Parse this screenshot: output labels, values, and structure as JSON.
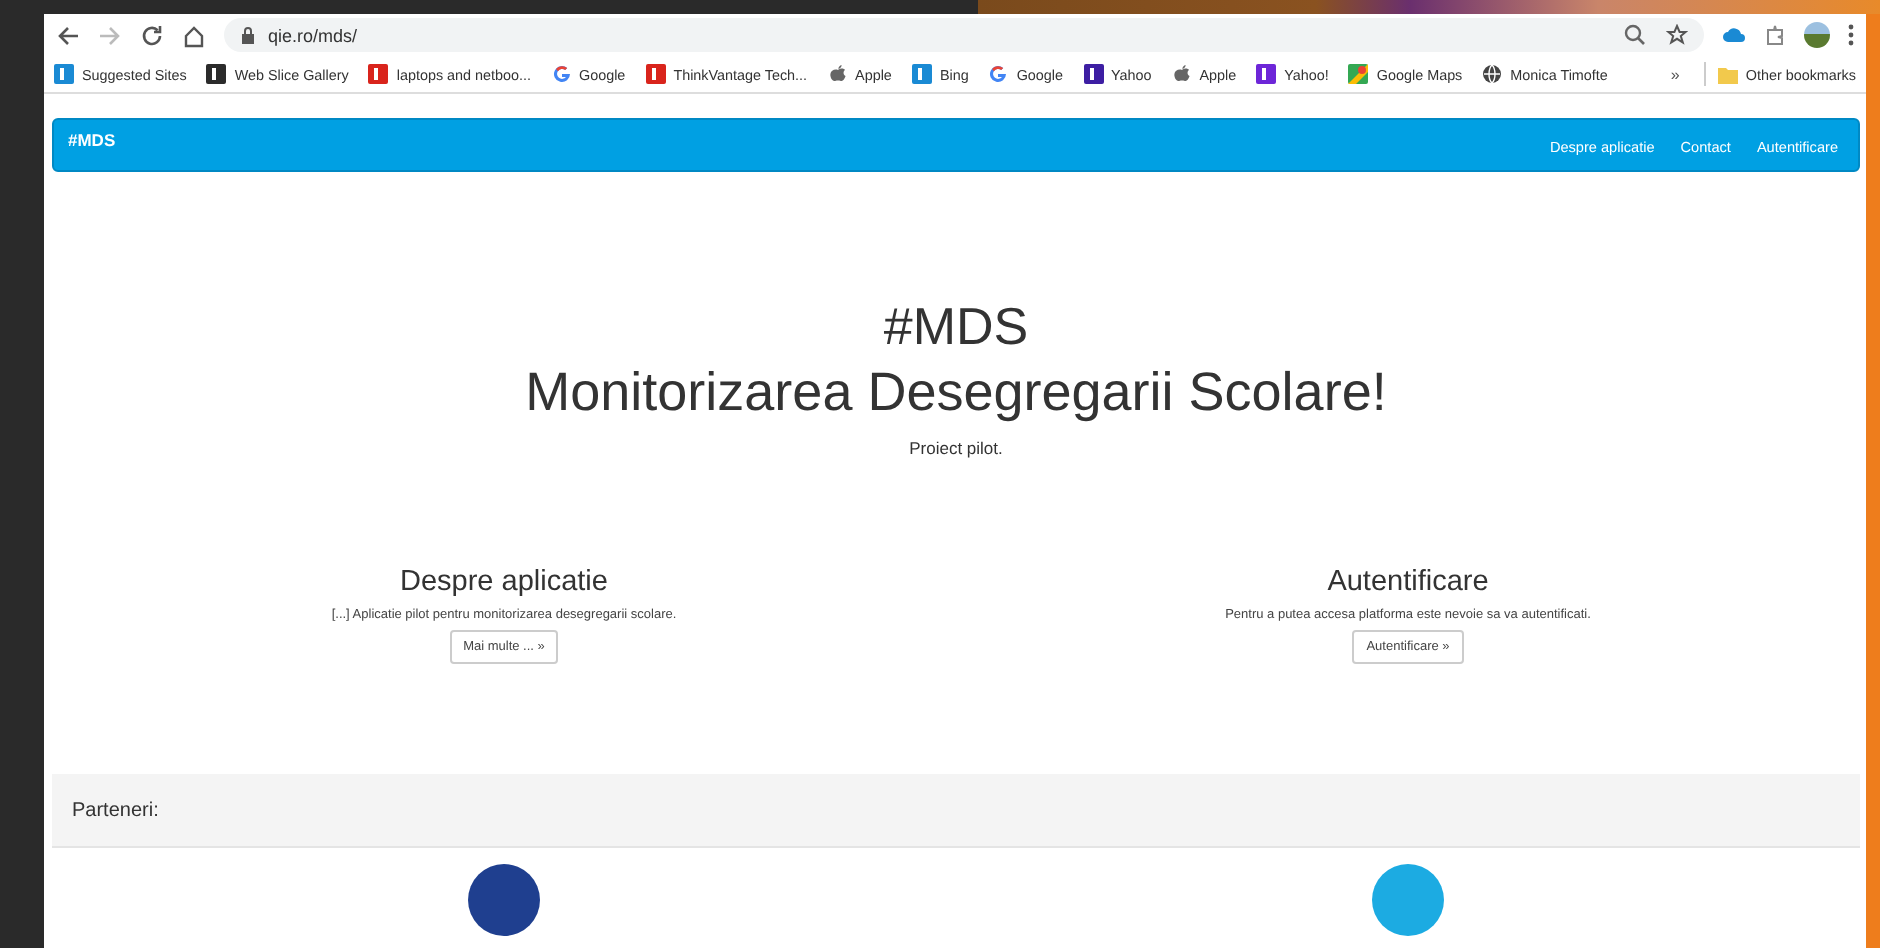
{
  "browser": {
    "url": "qie.ro/mds/",
    "bookmarks": [
      {
        "label": "Suggested Sites",
        "kind": "square",
        "color": "#1a8ad4"
      },
      {
        "label": "Web Slice Gallery",
        "kind": "square",
        "color": "#2b2b2b"
      },
      {
        "label": "laptops and netboo...",
        "kind": "square",
        "color": "#d9241c"
      },
      {
        "label": "Google",
        "kind": "google"
      },
      {
        "label": "ThinkVantage Tech...",
        "kind": "square",
        "color": "#d9241c"
      },
      {
        "label": "Apple",
        "kind": "apple"
      },
      {
        "label": "Bing",
        "kind": "square",
        "color": "#1a8ad4"
      },
      {
        "label": "Google",
        "kind": "google"
      },
      {
        "label": "Yahoo",
        "kind": "square",
        "color": "#3d1ea3"
      },
      {
        "label": "Apple",
        "kind": "apple"
      },
      {
        "label": "Yahoo!",
        "kind": "square",
        "color": "#6d26d8"
      },
      {
        "label": "Google Maps",
        "kind": "maps"
      },
      {
        "label": "Monica Timofte",
        "kind": "globe"
      }
    ],
    "overflow": "»",
    "other": "Other bookmarks"
  },
  "navbar": {
    "brand": "#MDS",
    "links": [
      "Despre aplicatie",
      "Contact",
      "Autentificare"
    ]
  },
  "hero": {
    "title": "#MDS",
    "subtitle": "Monitorizarea Desegregarii Scolare!",
    "lead": "Proiect pilot."
  },
  "columns": [
    {
      "heading": "Despre aplicatie",
      "text": "[...] Aplicatie pilot pentru monitorizarea desegregarii scolare.",
      "button": "Mai multe ... »"
    },
    {
      "heading": "Autentificare",
      "text": "Pentru a putea accesa platforma este nevoie sa va autentificati.",
      "button": "Autentificare »"
    }
  ],
  "partners": {
    "heading": "Parteneri:",
    "logos": [
      {
        "color": "#1f3f8f"
      },
      {
        "color": "#1cabe2"
      }
    ]
  }
}
